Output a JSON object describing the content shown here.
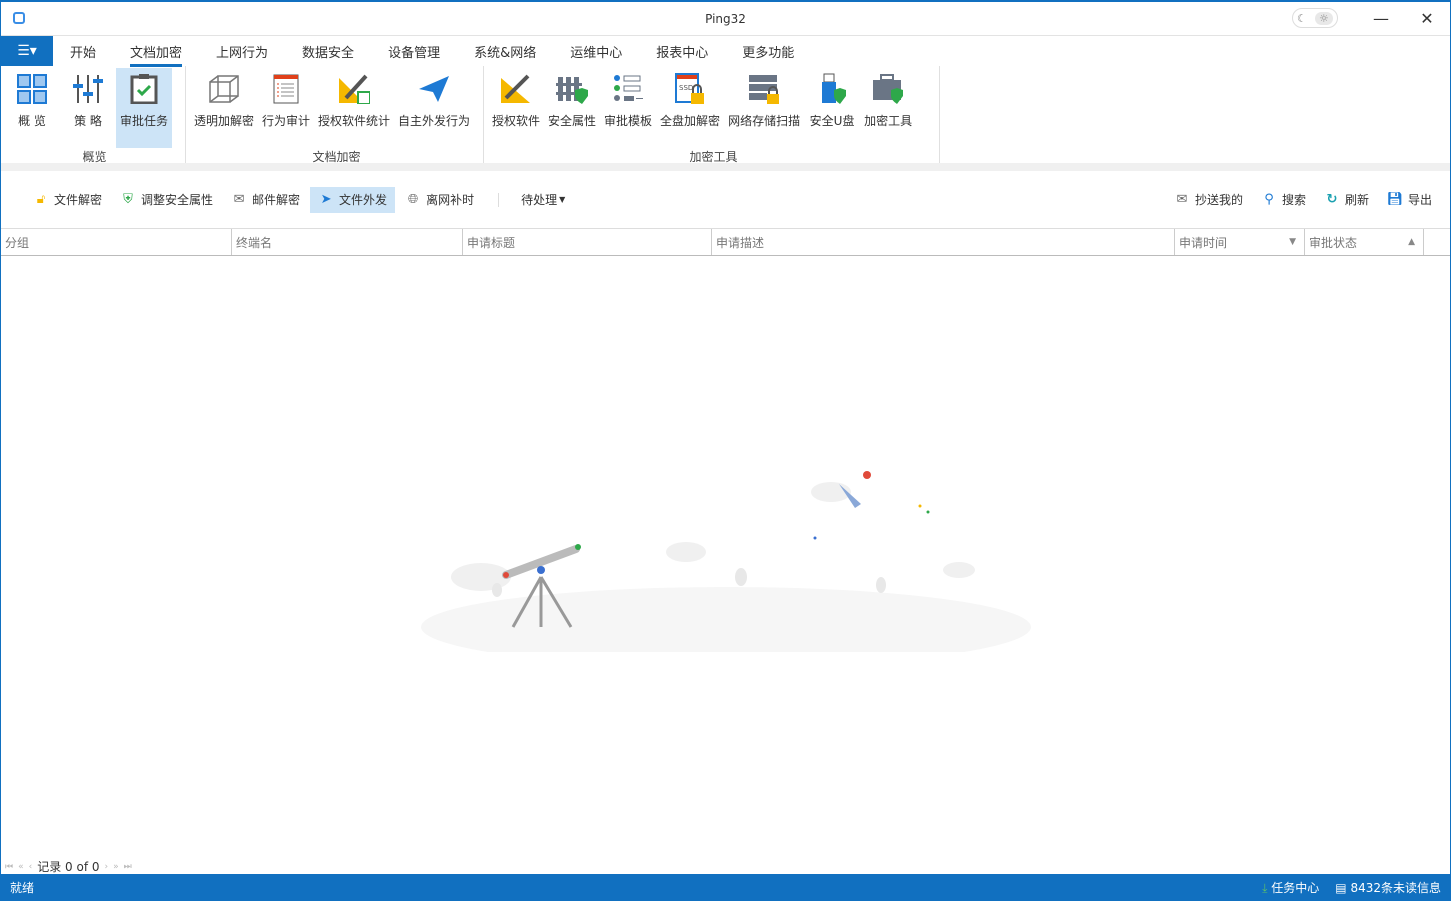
{
  "window": {
    "title": "Ping32",
    "minimize": "—",
    "close": "✕",
    "theme_dark": "☾",
    "theme_light": "☼"
  },
  "menu": {
    "app_icon": "☰▾",
    "tabs": [
      "开始",
      "文档加密",
      "上网行为",
      "数据安全",
      "设备管理",
      "系统&网络",
      "运维中心",
      "报表中心",
      "更多功能"
    ],
    "active": 1
  },
  "ribbon": {
    "groups": [
      {
        "label": "概览",
        "items": [
          "概 览",
          "策 略",
          "审批任务"
        ]
      },
      {
        "label": "文档加密",
        "items": [
          "透明加解密",
          "行为审计",
          "授权软件统计",
          "自主外发行为"
        ]
      },
      {
        "label": "加密工具",
        "items": [
          "授权软件",
          "安全属性",
          "审批模板",
          "全盘加解密",
          "网络存储扫描",
          "安全U盘",
          "加密工具"
        ]
      }
    ]
  },
  "toolbar": {
    "left": [
      "文件解密",
      "调整安全属性",
      "邮件解密",
      "文件外发",
      "离网补时"
    ],
    "filter": "待处理",
    "right": [
      "抄送我的",
      "搜索",
      "刷新",
      "导出"
    ]
  },
  "grid": {
    "columns": [
      "分组",
      "终端名",
      "申请标题",
      "申请描述",
      "申请时间",
      "审批状态"
    ]
  },
  "pager": {
    "text": "记录 0 of 0"
  },
  "status": {
    "left": "就绪",
    "task_center": "任务中心",
    "unread": "8432条未读信息"
  },
  "colors": {
    "accent": "#1170c0",
    "selected": "#cde4f7"
  }
}
